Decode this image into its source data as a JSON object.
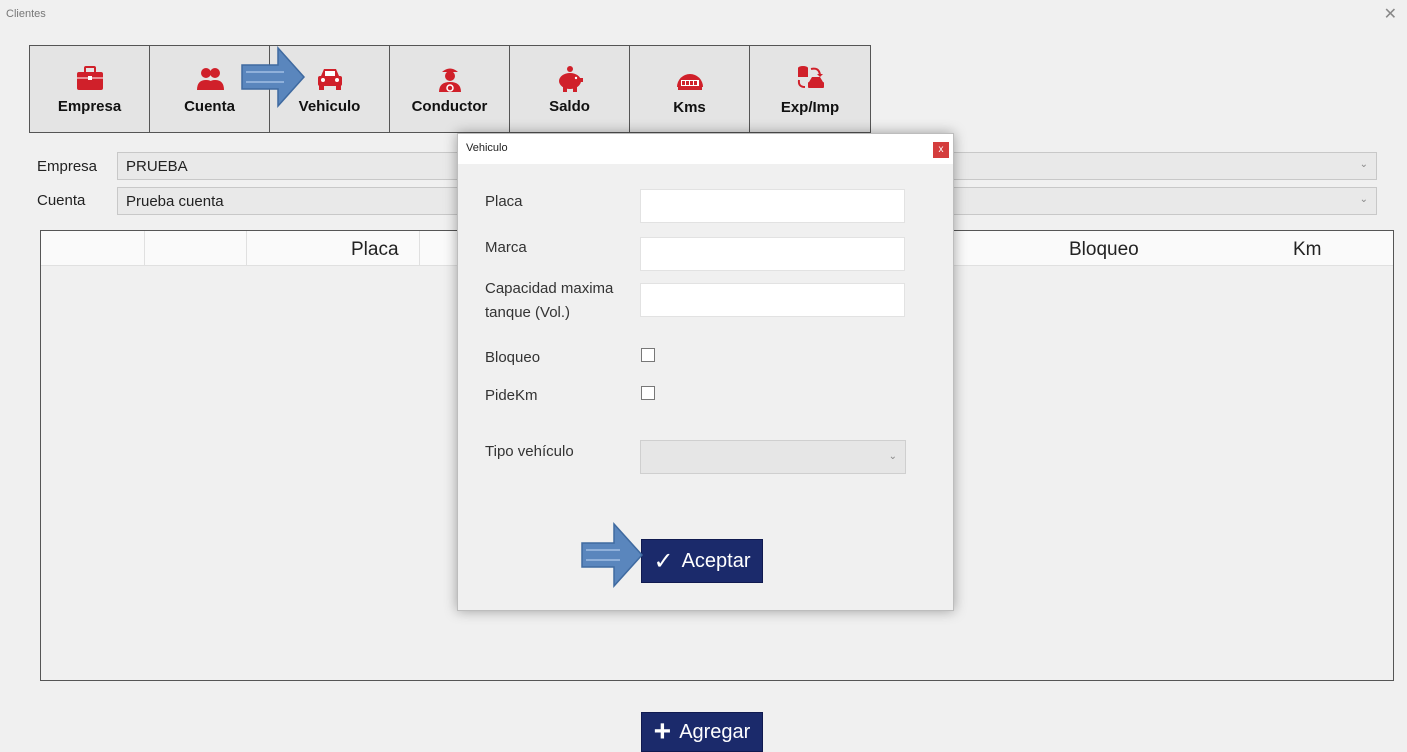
{
  "window": {
    "title": "Clientes",
    "close_glyph": "✕"
  },
  "toolbar": {
    "buttons": [
      {
        "label": "Empresa",
        "icon": "briefcase-icon"
      },
      {
        "label": "Cuenta",
        "icon": "users-icon"
      },
      {
        "label": "Vehiculo",
        "icon": "car-icon"
      },
      {
        "label": "Conductor",
        "icon": "driver-icon"
      },
      {
        "label": "Saldo",
        "icon": "piggy-bank-icon"
      },
      {
        "label": "Kms",
        "icon": "odometer-icon"
      },
      {
        "label": "Exp/Imp",
        "icon": "export-import-icon"
      }
    ]
  },
  "filters": {
    "empresa": {
      "label": "Empresa",
      "value": "PRUEBA"
    },
    "cuenta": {
      "label": "Cuenta",
      "value": "Prueba cuenta"
    }
  },
  "grid": {
    "columns": [
      "Placa",
      "Bloqueo",
      "Km"
    ]
  },
  "add_button": {
    "label": "Agregar",
    "glyph": "+"
  },
  "dialog": {
    "title": "Vehiculo",
    "close_glyph": "x",
    "fields": {
      "placa": {
        "label": "Placa",
        "value": ""
      },
      "marca": {
        "label": "Marca",
        "value": ""
      },
      "capacidad": {
        "label_line1": "Capacidad maxima",
        "label_line2": "tanque (Vol.)",
        "value": ""
      },
      "bloqueo": {
        "label": "Bloqueo",
        "checked": false
      },
      "pidekm": {
        "label": "PideKm",
        "checked": false
      },
      "tipo": {
        "label": "Tipo vehículo",
        "value": ""
      }
    },
    "ok_button": {
      "label": "Aceptar",
      "glyph": "✓"
    }
  },
  "colors": {
    "icon_red": "#d0202a",
    "button_navy": "#1b2a6b",
    "arrow_blue": "#5a86bd"
  }
}
